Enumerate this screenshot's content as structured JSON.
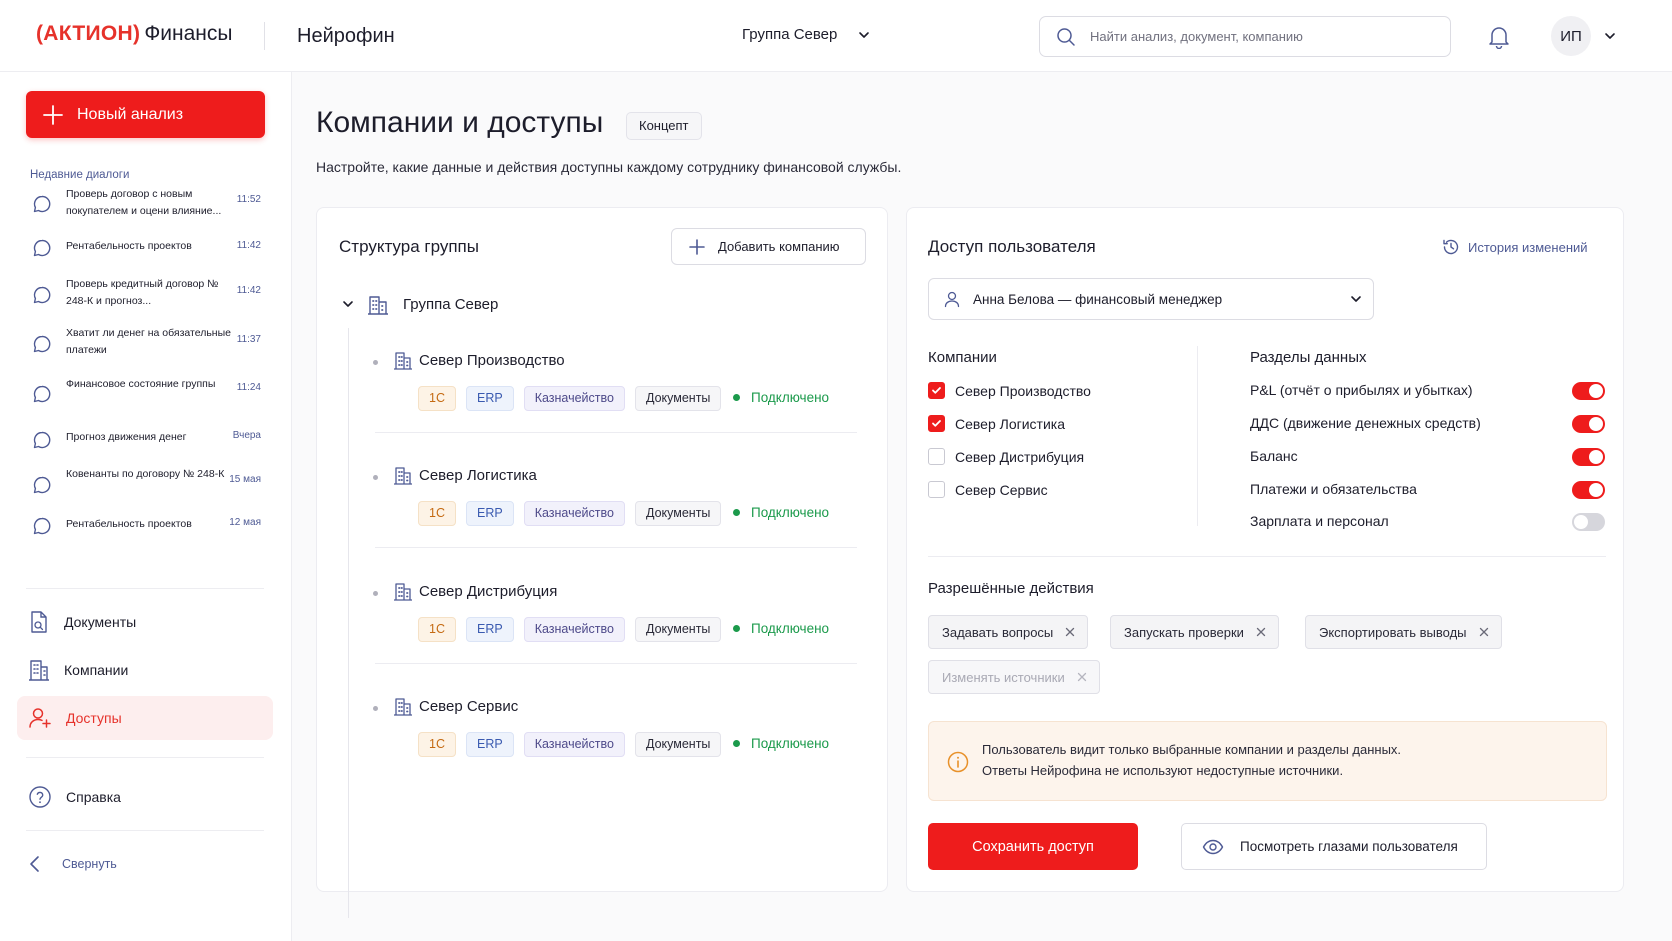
{
  "header": {
    "brand": "(АКТИОН)",
    "brand_suffix": "Финансы",
    "product": "Нейрофин",
    "group": "Группа Север",
    "search_placeholder": "Найти анализ, документ, компанию",
    "avatar": "ИП"
  },
  "sidebar": {
    "new_analysis": "Новый анализ",
    "recent_title": "Недавние диалоги",
    "dialogs": [
      {
        "text": "Проверь договор с новым покупателем и оцени влияние...",
        "time": "11:52"
      },
      {
        "text": "Рентабельность проектов",
        "time": "11:42"
      },
      {
        "text": "Проверь кредитный договор № 248-К и прогноз...",
        "time": "11:42"
      },
      {
        "text": "Хватит ли денег на обязательные платежи",
        "time": "11:37"
      },
      {
        "text": "Финансовое состояние группы",
        "time": "11:24"
      },
      {
        "text": "Прогноз движения денег",
        "time": "Вчера"
      },
      {
        "text": "Ковенанты по договору № 248-К",
        "time": "15 мая"
      },
      {
        "text": "Рентабельность проектов",
        "time": "12 мая"
      }
    ],
    "nav": [
      {
        "label": "Документы"
      },
      {
        "label": "Компании"
      },
      {
        "label": "Доступы"
      },
      {
        "label": "Справка"
      }
    ],
    "collapse": "Свернуть"
  },
  "page": {
    "title": "Компании и доступы",
    "badge": "Концепт",
    "subtitle": "Настройте, какие данные и действия доступны каждому сотруднику финансовой службы."
  },
  "structure": {
    "title": "Структура группы",
    "add_company": "Добавить компанию",
    "root": "Группа Север",
    "companies": [
      {
        "name": "Север Производство",
        "tags": [
          "1С",
          "ERP",
          "Казначейство",
          "Документы"
        ],
        "status": "Подключено"
      },
      {
        "name": "Север Логистика",
        "tags": [
          "1С",
          "ERP",
          "Казначейство",
          "Документы"
        ],
        "status": "Подключено"
      },
      {
        "name": "Север Дистрибуция",
        "tags": [
          "1С",
          "ERP",
          "Казначейство",
          "Документы"
        ],
        "status": "Подключено"
      },
      {
        "name": "Север Сервис",
        "tags": [
          "1С",
          "ERP",
          "Казначейство",
          "Документы"
        ],
        "status": "Подключено"
      }
    ]
  },
  "access": {
    "title": "Доступ пользователя",
    "history": "История изменений",
    "user": "Анна Белова — финансовый менеджер",
    "companies_title": "Компании",
    "companies": [
      {
        "label": "Север Производство",
        "checked": true
      },
      {
        "label": "Север Логистика",
        "checked": true
      },
      {
        "label": "Север Дистрибуция",
        "checked": false
      },
      {
        "label": "Север Сервис",
        "checked": false
      }
    ],
    "sections_title": "Разделы данных",
    "sections": [
      {
        "label": "P&L (отчёт о прибылях и убытках)",
        "on": true
      },
      {
        "label": "ДДС (движение денежных средств)",
        "on": true
      },
      {
        "label": "Баланс",
        "on": true
      },
      {
        "label": "Платежи и обязательства",
        "on": true
      },
      {
        "label": "Зарплата и персонал",
        "on": false
      }
    ],
    "actions_title": "Разрешённые действия",
    "actions": [
      {
        "label": "Задавать вопросы",
        "enabled": true
      },
      {
        "label": "Запускать проверки",
        "enabled": true
      },
      {
        "label": "Экспортировать выводы",
        "enabled": true
      },
      {
        "label": "Изменять источники",
        "enabled": false
      }
    ],
    "notice_line1": "Пользователь видит только выбранные компании и разделы данных.",
    "notice_line2": "Ответы Нейрофина не используют недоступные источники.",
    "save": "Сохранить доступ",
    "view_as": "Посмотреть глазами пользователя"
  },
  "colors": {
    "accent": "#ee1c1c",
    "brand": "#e6322b",
    "success": "#1b9a4b",
    "muted": "#4e5a94"
  }
}
